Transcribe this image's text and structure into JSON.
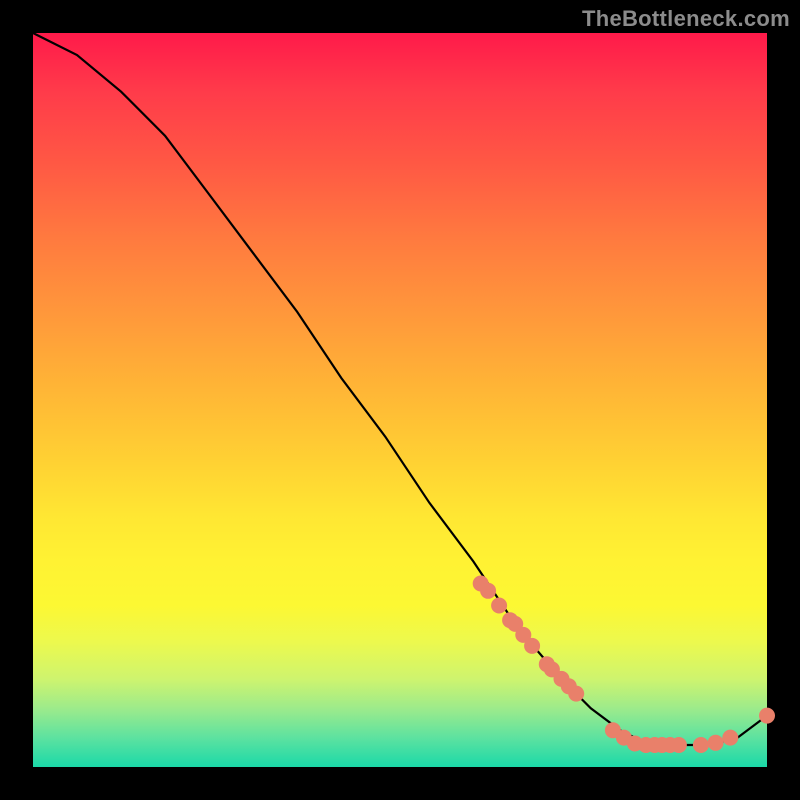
{
  "watermark": "TheBottleneck.com",
  "chart_data": {
    "type": "line",
    "title": "",
    "xlabel": "",
    "ylabel": "",
    "xlim": [
      0,
      100
    ],
    "ylim": [
      0,
      100
    ],
    "grid": false,
    "legend": false,
    "series": [
      {
        "name": "curve",
        "color": "#000000",
        "x": [
          0,
          6,
          12,
          18,
          24,
          30,
          36,
          42,
          48,
          54,
          60,
          66,
          72,
          76,
          80,
          84,
          88,
          92,
          96,
          100
        ],
        "y": [
          100,
          97,
          92,
          86,
          78,
          70,
          62,
          53,
          45,
          36,
          28,
          19,
          12,
          8,
          5,
          3,
          3,
          3,
          4,
          7
        ]
      }
    ],
    "markers": [
      {
        "name": "data-points",
        "color": "#e9806a",
        "radius": 8,
        "points": [
          {
            "x": 61,
            "y": 25
          },
          {
            "x": 62,
            "y": 24
          },
          {
            "x": 63.5,
            "y": 22
          },
          {
            "x": 65,
            "y": 20
          },
          {
            "x": 65.7,
            "y": 19.5
          },
          {
            "x": 66.8,
            "y": 18
          },
          {
            "x": 68,
            "y": 16.5
          },
          {
            "x": 70,
            "y": 14
          },
          {
            "x": 70.7,
            "y": 13.3
          },
          {
            "x": 72,
            "y": 12
          },
          {
            "x": 73,
            "y": 11
          },
          {
            "x": 74,
            "y": 10
          },
          {
            "x": 79,
            "y": 5
          },
          {
            "x": 80.5,
            "y": 4
          },
          {
            "x": 82,
            "y": 3.2
          },
          {
            "x": 83.5,
            "y": 3
          },
          {
            "x": 84.7,
            "y": 3
          },
          {
            "x": 85.7,
            "y": 3
          },
          {
            "x": 86.8,
            "y": 3
          },
          {
            "x": 88,
            "y": 3
          },
          {
            "x": 91,
            "y": 3
          },
          {
            "x": 93,
            "y": 3.3
          },
          {
            "x": 95,
            "y": 4
          },
          {
            "x": 100,
            "y": 7
          }
        ]
      }
    ]
  }
}
